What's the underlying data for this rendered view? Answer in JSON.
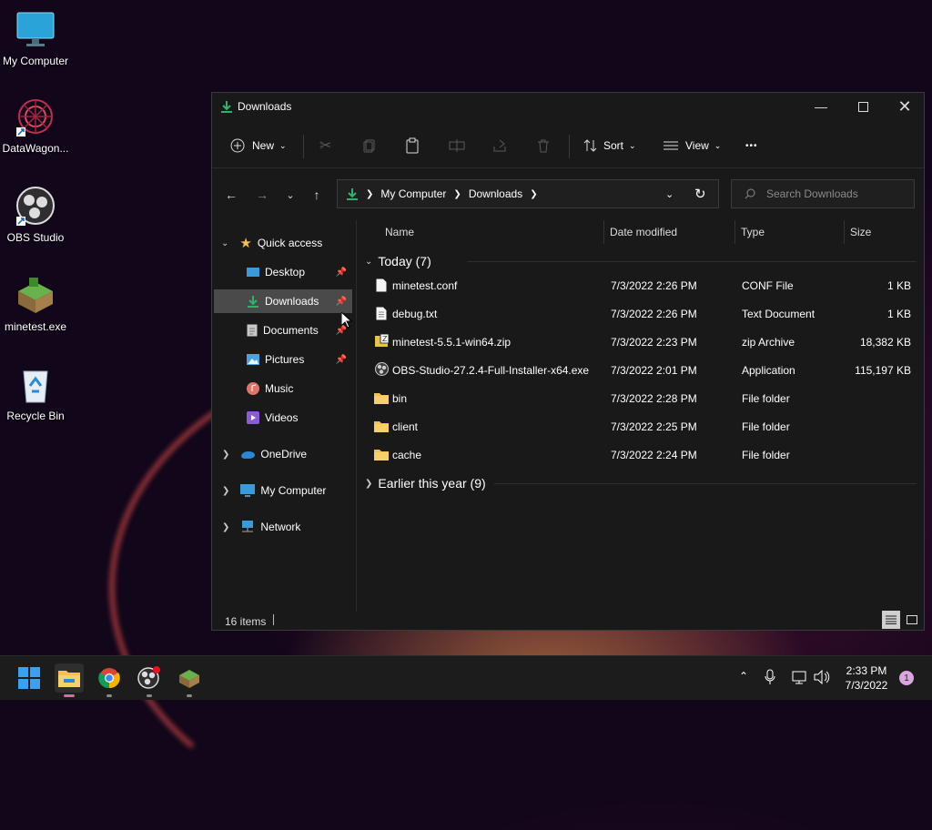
{
  "desktop": {
    "icons": [
      {
        "label": "My Computer"
      },
      {
        "label": "DataWagon..."
      },
      {
        "label": "OBS Studio"
      },
      {
        "label": "minetest.exe"
      },
      {
        "label": "Recycle Bin"
      }
    ]
  },
  "window": {
    "title": "Downloads",
    "toolbar": {
      "new_label": "New",
      "sort_label": "Sort",
      "view_label": "View",
      "more_label": "•••"
    },
    "address": {
      "crumbs": [
        "My Computer",
        "Downloads"
      ]
    },
    "search": {
      "placeholder": "Search Downloads"
    },
    "sidebar": {
      "quick_access": "Quick access",
      "items": [
        {
          "label": "Desktop"
        },
        {
          "label": "Downloads"
        },
        {
          "label": "Documents"
        },
        {
          "label": "Pictures"
        },
        {
          "label": "Music"
        },
        {
          "label": "Videos"
        }
      ],
      "onedrive": "OneDrive",
      "mycomputer": "My Computer",
      "network": "Network"
    },
    "columns": {
      "name": "Name",
      "date": "Date modified",
      "type": "Type",
      "size": "Size"
    },
    "groups": {
      "today": "Today (7)",
      "earlier": "Earlier this year (9)"
    },
    "files": [
      {
        "name": "minetest.conf",
        "date": "7/3/2022 2:26 PM",
        "type": "CONF File",
        "size": "1 KB"
      },
      {
        "name": "debug.txt",
        "date": "7/3/2022 2:26 PM",
        "type": "Text Document",
        "size": "1 KB"
      },
      {
        "name": "minetest-5.5.1-win64.zip",
        "date": "7/3/2022 2:23 PM",
        "type": "zip Archive",
        "size": "18,382 KB"
      },
      {
        "name": "OBS-Studio-27.2.4-Full-Installer-x64.exe",
        "date": "7/3/2022 2:01 PM",
        "type": "Application",
        "size": "115,197 KB"
      },
      {
        "name": "bin",
        "date": "7/3/2022 2:28 PM",
        "type": "File folder",
        "size": ""
      },
      {
        "name": "client",
        "date": "7/3/2022 2:25 PM",
        "type": "File folder",
        "size": ""
      },
      {
        "name": "cache",
        "date": "7/3/2022 2:24 PM",
        "type": "File folder",
        "size": ""
      }
    ],
    "status": {
      "items": "16 items"
    }
  },
  "taskbar": {
    "time": "2:33 PM",
    "date": "7/3/2022",
    "notifications": "1"
  },
  "colors": {
    "accent": "#2fb36b",
    "folder": "#f2c14e",
    "selection": "#4a4a4a"
  }
}
